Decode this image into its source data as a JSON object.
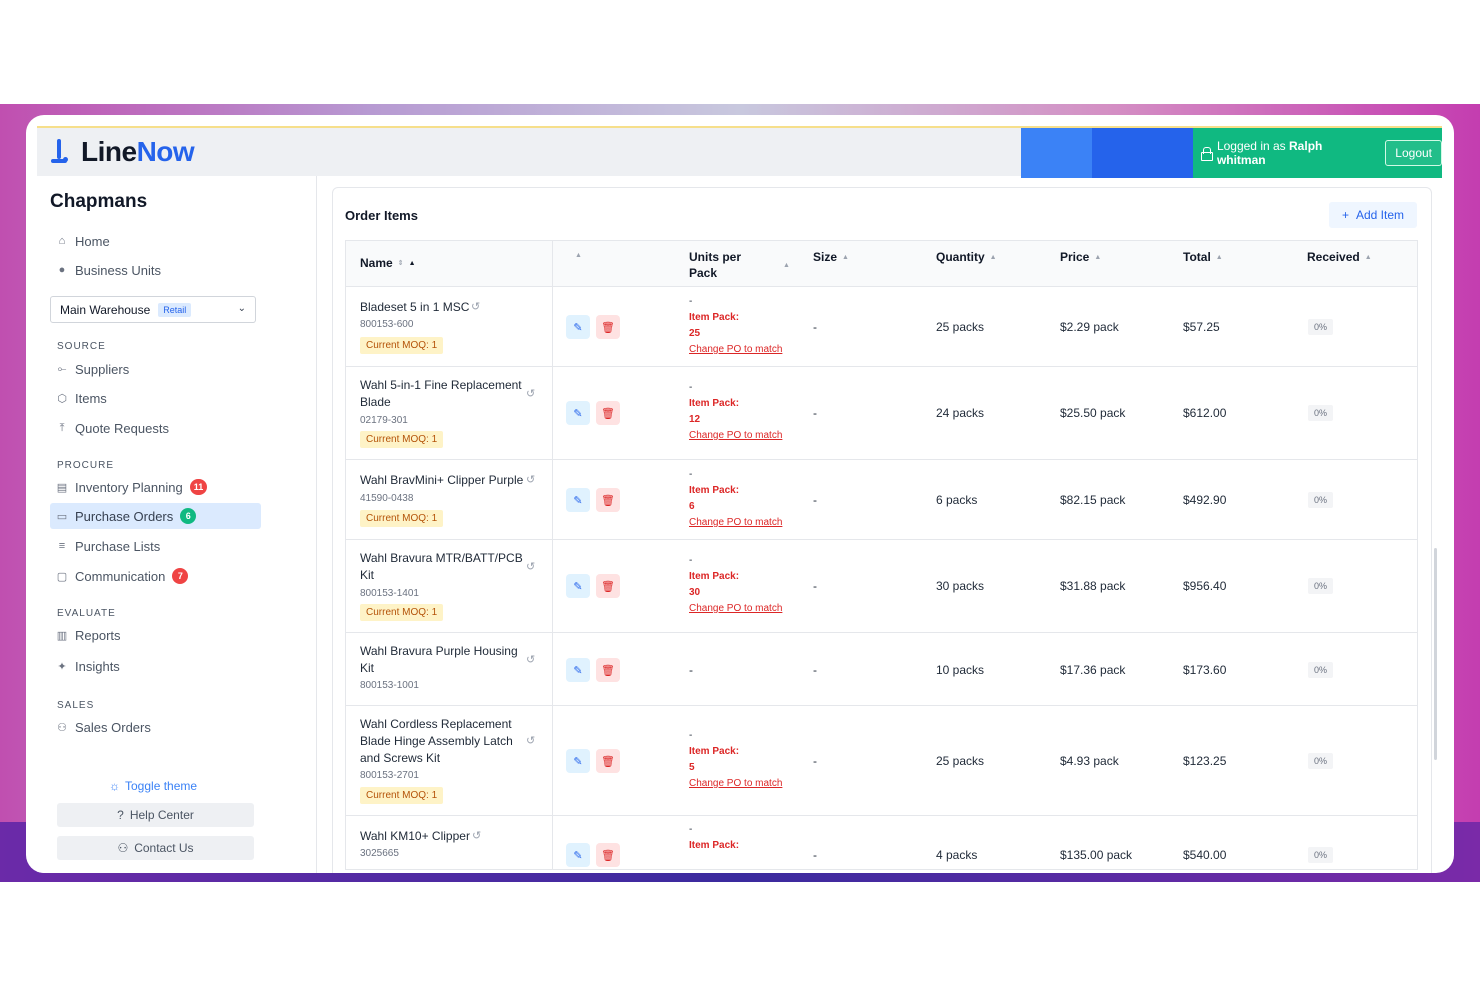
{
  "app": {
    "brand_line": "Line",
    "brand_now": "Now",
    "logged_prefix": "Logged in as",
    "user_name": "Ralph whitman",
    "logout_label": "Logout"
  },
  "sidebar": {
    "org_name": "Chapmans",
    "home": "Home",
    "business_units": "Business Units",
    "warehouse": "Main Warehouse",
    "warehouse_tag": "Retail",
    "source_label": "SOURCE",
    "suppliers": "Suppliers",
    "items": "Items",
    "quote_requests": "Quote Requests",
    "procure_label": "PROCURE",
    "inventory_planning": "Inventory Planning",
    "inventory_badge": "11",
    "purchase_orders": "Purchase Orders",
    "purchase_orders_badge": "6",
    "purchase_lists": "Purchase Lists",
    "communication": "Communication",
    "communication_badge": "7",
    "evaluate_label": "EVALUATE",
    "reports": "Reports",
    "insights": "Insights",
    "sales_label": "SALES",
    "sales_orders": "Sales Orders",
    "toggle_theme": "Toggle theme",
    "help_center": "Help Center",
    "contact_us": "Contact Us"
  },
  "main": {
    "title": "Order Items",
    "add_item": "Add Item",
    "columns": {
      "name": "Name",
      "units_per_pack_1": "Units per",
      "units_per_pack_2": "Pack",
      "size": "Size",
      "quantity": "Quantity",
      "price": "Price",
      "total": "Total",
      "received": "Received"
    },
    "rows": [
      {
        "name": "Bladeset 5 in 1 MSC",
        "sku": "800153-600",
        "moq": "Current MOQ: 1",
        "upp_dash": "-",
        "pack_label": "Item Pack:",
        "pack_value": "25",
        "change_link": "Change PO to match",
        "size": "-",
        "quantity": "25 packs",
        "price": "$2.29 pack",
        "total": "$57.25",
        "received": "0%"
      },
      {
        "name": "Wahl 5-in-1 Fine Replacement Blade",
        "sku": "02179-301",
        "moq": "Current MOQ: 1",
        "upp_dash": "-",
        "pack_label": "Item Pack:",
        "pack_value": "12",
        "change_link": "Change PO to match",
        "size": "-",
        "quantity": "24 packs",
        "price": "$25.50 pack",
        "total": "$612.00",
        "received": "0%"
      },
      {
        "name": "Wahl BravMini+ Clipper Purple",
        "sku": "41590-0438",
        "moq": "Current MOQ: 1",
        "upp_dash": "-",
        "pack_label": "Item Pack:",
        "pack_value": "6",
        "change_link": "Change PO to match",
        "size": "-",
        "quantity": "6 packs",
        "price": "$82.15 pack",
        "total": "$492.90",
        "received": "0%"
      },
      {
        "name": "Wahl Bravura MTR/BATT/PCB Kit",
        "sku": "800153-1401",
        "moq": "Current MOQ: 1",
        "upp_dash": "-",
        "pack_label": "Item Pack:",
        "pack_value": "30",
        "change_link": "Change PO to match",
        "size": "-",
        "quantity": "30 packs",
        "price": "$31.88 pack",
        "total": "$956.40",
        "received": "0%"
      },
      {
        "name": "Wahl Bravura Purple Housing Kit",
        "sku": "800153-1001",
        "moq": "",
        "upp_dash": "-",
        "pack_label": "",
        "pack_value": "",
        "change_link": "",
        "size": "-",
        "quantity": "10 packs",
        "price": "$17.36 pack",
        "total": "$173.60",
        "received": "0%"
      },
      {
        "name": "Wahl Cordless Replacement Blade Hinge Assembly Latch and Screws Kit",
        "sku": "800153-2701",
        "moq": "Current MOQ: 1",
        "upp_dash": "-",
        "pack_label": "Item Pack:",
        "pack_value": "5",
        "change_link": "Change PO to match",
        "size": "-",
        "quantity": "25 packs",
        "price": "$4.93 pack",
        "total": "$123.25",
        "received": "0%"
      },
      {
        "name": "Wahl KM10+ Clipper",
        "sku": "3025665",
        "moq": "",
        "upp_dash": "-",
        "pack_label": "Item Pack:",
        "pack_value": "",
        "change_link": "",
        "size": "-",
        "quantity": "4 packs",
        "price": "$135.00 pack",
        "total": "$540.00",
        "received": "0%"
      }
    ]
  },
  "colors": {
    "brand_blue": "#2563eb",
    "logged_green": "#10b981",
    "active_nav": "#dbeafe",
    "moq_bg": "#fef3c7",
    "alert_red": "#dc2626"
  },
  "icons": [
    "home-icon",
    "business-units-icon",
    "suppliers-icon",
    "items-icon",
    "quote-requests-icon",
    "inventory-icon",
    "purchase-orders-icon",
    "purchase-lists-icon",
    "communication-icon",
    "reports-icon",
    "insights-icon",
    "sales-orders-icon",
    "sun-icon",
    "help-icon",
    "contact-icon",
    "lock-icon",
    "plus-icon",
    "pencil-icon",
    "trash-icon",
    "history-icon",
    "chevron-down-icon",
    "sort-icon"
  ]
}
